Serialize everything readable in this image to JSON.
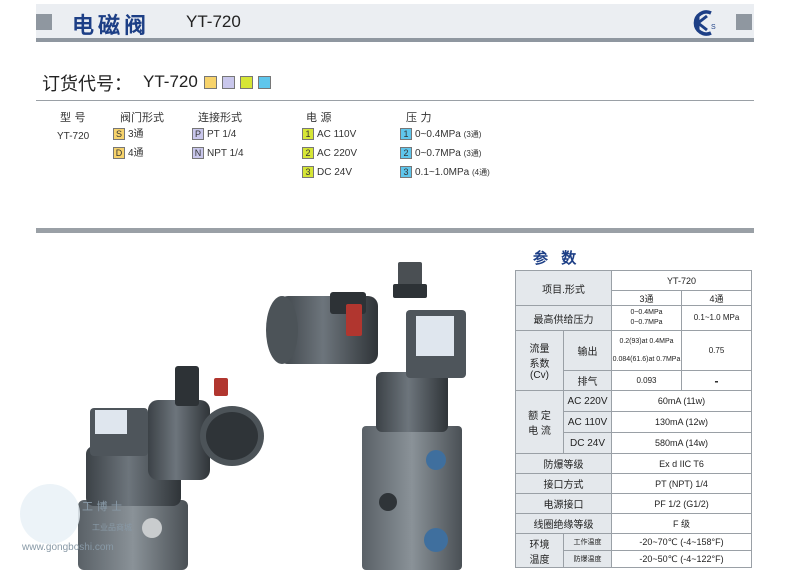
{
  "header": {
    "title": "电磁阀",
    "model": "YT-720",
    "logo": "KC"
  },
  "order": {
    "title": "订货代号：",
    "model": "YT-720",
    "code_boxes": [
      "#f7d36b",
      "#c9c7ec",
      "#d6e636",
      "#5fc6ec"
    ],
    "columns": [
      "型 号",
      "阀门形式",
      "连接形式",
      "电 源",
      "压 力"
    ],
    "model_value": "YT-720",
    "valve": [
      {
        "code": "S",
        "label": "3通"
      },
      {
        "code": "D",
        "label": "4通"
      }
    ],
    "connection": [
      {
        "code": "P",
        "label": "PT  1/4"
      },
      {
        "code": "N",
        "label": "NPT  1/4"
      }
    ],
    "power": [
      {
        "code": "1",
        "label": "AC 110V"
      },
      {
        "code": "2",
        "label": "AC 220V"
      },
      {
        "code": "3",
        "label": "DC 24V"
      }
    ],
    "pressure": [
      {
        "code": "1",
        "label": "0~0.4MPa",
        "note": "(3通)"
      },
      {
        "code": "2",
        "label": "0~0.7MPa",
        "note": "(3通)"
      },
      {
        "code": "3",
        "label": "0.1~1.0MPa",
        "note": "(4通)"
      }
    ]
  },
  "params": {
    "title": "参 数",
    "model": "YT-720",
    "item_form": "项目.形式",
    "three_way": "3通",
    "four_way": "4通",
    "max_pressure": {
      "label": "最高供给压力",
      "v3a": "0~0.4MPa",
      "v3b": "0~0.7MPa",
      "v4": "0.1~1.0 MPa"
    },
    "flow": {
      "label_a": "流量",
      "label_b": "系数",
      "label_c": "(Cv)",
      "output": "输出",
      "out_v3a": "0.2(93)at 0.4MPa",
      "out_v3b": "0.084(61.6)at 0.7MPa",
      "out_v4": "0.75",
      "exhaust": "排气",
      "ex_v3": "0.093",
      "ex_v4": "-"
    },
    "current": {
      "label_a": "额 定",
      "label_b": "电 流",
      "rows": [
        {
          "k": "AC 220V",
          "v": "60mA (11w)"
        },
        {
          "k": "AC 110V",
          "v": "130mA (12w)"
        },
        {
          "k": "DC 24V",
          "v": "580mA (14w)"
        }
      ]
    },
    "explosion": {
      "label": "防爆等级",
      "value": "Ex d IIC T6"
    },
    "port": {
      "label": "接口方式",
      "value": "PT (NPT) 1/4"
    },
    "elec_port": {
      "label": "电源接口",
      "value": "PF 1/2 (G1/2)"
    },
    "insulation": {
      "label": "线圈绝缘等级",
      "value": "F 级"
    },
    "env_temp": {
      "label_a": "环境",
      "label_b": "温度",
      "work": "工作温度",
      "work_v": "-20~70℃ (-4~158°F)",
      "protect": "防爆温度",
      "protect_v": "-20~50℃ (-4~122°F)"
    }
  },
  "watermark": {
    "cn": "工 博 士",
    "sub": "工业品商城",
    "url": "www.gongboshi.com"
  }
}
